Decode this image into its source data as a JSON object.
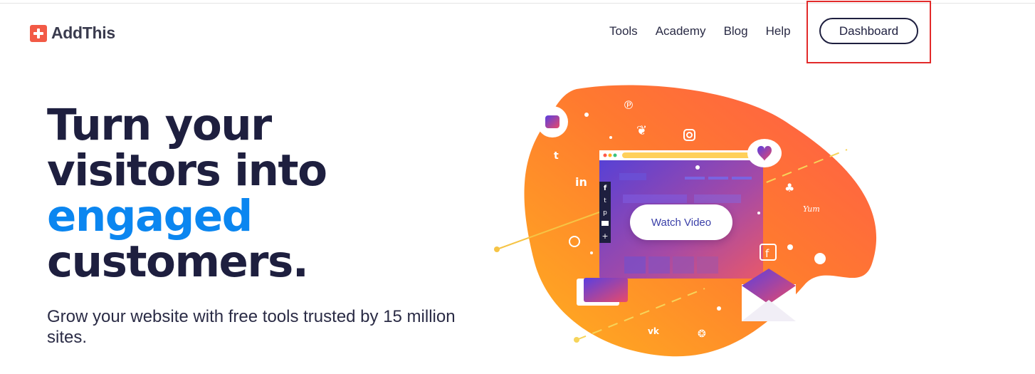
{
  "header": {
    "logo_text": "AddThis",
    "nav": [
      "Tools",
      "Academy",
      "Blog",
      "Help"
    ],
    "dashboard_label": "Dashboard"
  },
  "hero": {
    "headline_line1": "Turn your",
    "headline_line2": "visitors into",
    "headline_accent": "engaged",
    "headline_line4": "customers.",
    "subheadline": "Grow your website with free tools trusted by 15 million sites."
  },
  "illustration": {
    "watch_video_label": "Watch Video"
  },
  "colors": {
    "brand_red": "#f25a46",
    "text_dark": "#1e1f3f",
    "accent_blue": "#0b86f0",
    "highlight": "#e22a2a"
  }
}
